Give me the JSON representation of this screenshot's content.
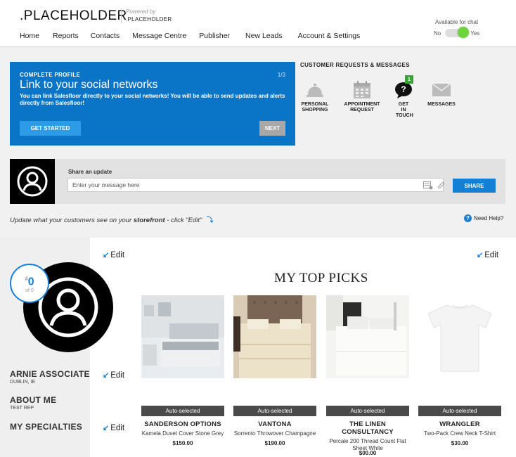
{
  "header": {
    "logo": ".PLACEHOLDER",
    "powered_by": "Powered by",
    "powered_brand": ".PLACEHOLDER",
    "nav": [
      "Home",
      "Reports",
      "Contacts",
      "Message Centre",
      "Publisher",
      "New Leads",
      "Account & Settings"
    ],
    "chat_label": "Available for chat",
    "chat_no": "No",
    "chat_yes": "Yes",
    "chat_available": true
  },
  "profile_card": {
    "kicker": "COMPLETE PROFILE",
    "counter": "1/3",
    "title": "Link to your social networks",
    "body": "You can link Salesfloor directly to your social networks! You will be able to send updates and alerts directly from Salesfloor!",
    "start_label": "GET STARTED",
    "next_label": "NEXT"
  },
  "requests": {
    "title": "CUSTOMER REQUESTS & MESSAGES",
    "items": [
      {
        "label": "PERSONAL SHOPPING",
        "icon": "bell-icon"
      },
      {
        "label": "APPOINTMENT REQUEST",
        "icon": "calendar-icon"
      },
      {
        "label": "GET IN TOUCH",
        "icon": "question-icon",
        "badge": "1"
      },
      {
        "label": "MESSAGES",
        "icon": "envelope-icon"
      }
    ]
  },
  "share": {
    "label": "Share an update",
    "placeholder": "Enter your message here",
    "button": "SHARE"
  },
  "storefront_note": {
    "prefix": "Update what your customers see on your ",
    "bold": "storefront",
    "suffix": " - click \"Edit\""
  },
  "need_help": "Need Help?",
  "edit_label": "Edit",
  "profile": {
    "rank": "0",
    "rank_prefix": "#",
    "rank_of": "of 0",
    "name": "ARNIE ASSOCIATE",
    "location": "DUBLIN, IE",
    "about_title": "ABOUT ME",
    "about_text": "TEST REP",
    "specialties_title": "MY SPECIALTIES"
  },
  "top_picks": {
    "title": "MY TOP PICKS",
    "products": [
      {
        "auto": "Auto-selected",
        "brand": "SANDERSON OPTIONS",
        "desc": "Kamela Duvet Cover Stone Grey",
        "price": "$150.00"
      },
      {
        "auto": "Auto-selected",
        "brand": "VANTONA",
        "desc": "Sorrento Throwover Champagne",
        "price": "$190.00"
      },
      {
        "auto": "Auto-selected",
        "brand": "THE LINEN CONSULTANCY",
        "desc": "Percale 200 Thread Count Flat Sheet White",
        "price": "$00.00"
      },
      {
        "auto": "Auto-selected",
        "brand": "WRANGLER",
        "desc": "Two-Pack Crew Neck T-Shirt",
        "price": "$30.00"
      }
    ]
  },
  "colors": {
    "accent_blue": "#0a74c6",
    "button_blue": "#1380d6",
    "badge_green": "#3aa335",
    "toggle_green": "#6dd43c"
  }
}
